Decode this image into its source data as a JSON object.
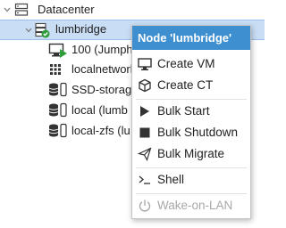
{
  "tree": {
    "datacenter": "Datacenter",
    "node": "lumbridge",
    "items": [
      {
        "label": "100 (Jumph",
        "icon": "vm-running-icon"
      },
      {
        "label": "localnetwork",
        "icon": "network-icon"
      },
      {
        "label": "SSD-storag",
        "icon": "storage-icon"
      },
      {
        "label": "local (lumb",
        "icon": "storage-icon"
      },
      {
        "label": "local-zfs (lu",
        "icon": "storage-icon"
      }
    ]
  },
  "menu": {
    "title": "Node 'lumbridge'",
    "items": [
      {
        "label": "Create VM",
        "icon": "monitor-icon"
      },
      {
        "label": "Create CT",
        "icon": "cube-icon"
      },
      {
        "label": "Bulk Start",
        "icon": "play-icon"
      },
      {
        "label": "Bulk Shutdown",
        "icon": "stop-icon"
      },
      {
        "label": "Bulk Migrate",
        "icon": "send-icon"
      },
      {
        "label": "Shell",
        "icon": "terminal-icon"
      },
      {
        "label": "Wake-on-LAN",
        "icon": "power-icon",
        "disabled": true
      }
    ]
  },
  "colors": {
    "menu_header": "#3d8fd0",
    "selection": "#c9def5",
    "status_green": "#2e9e3a",
    "disabled_text": "#a8a8a8"
  }
}
